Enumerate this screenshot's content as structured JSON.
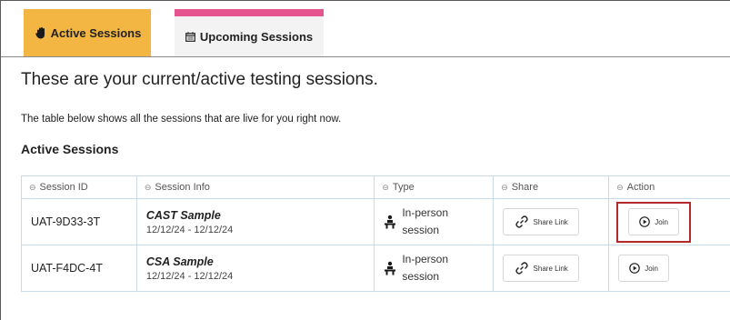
{
  "tabs": {
    "active_label": "Active Sessions",
    "upcoming_label": "Upcoming Sessions",
    "active_icon": "hand-icon",
    "upcoming_icon": "calendar-icon",
    "active_color": "#f4b642",
    "upcoming_accent_color": "#e5548e"
  },
  "main": {
    "heading": "These are your current/active testing sessions.",
    "description": "The table below shows all the sessions that are live for you right now.",
    "section_title": "Active Sessions"
  },
  "table": {
    "columns": [
      "Session ID",
      "Session Info",
      "Type",
      "Share",
      "Action"
    ],
    "rows": [
      {
        "session_id": "UAT-9D33-3T",
        "name": "CAST Sample",
        "dates": "12/12/24 - 12/12/24",
        "type_line1": "In-person",
        "type_line2": "session",
        "share_label": "Share Link",
        "action_label": "Join",
        "highlighted": true
      },
      {
        "session_id": "UAT-F4DC-4T",
        "name": "CSA Sample",
        "dates": "12/12/24 - 12/12/24",
        "type_line1": "In-person",
        "type_line2": "session",
        "share_label": "Share Link",
        "action_label": "Join",
        "highlighted": false
      }
    ],
    "highlight_color": "#b22a2a"
  }
}
